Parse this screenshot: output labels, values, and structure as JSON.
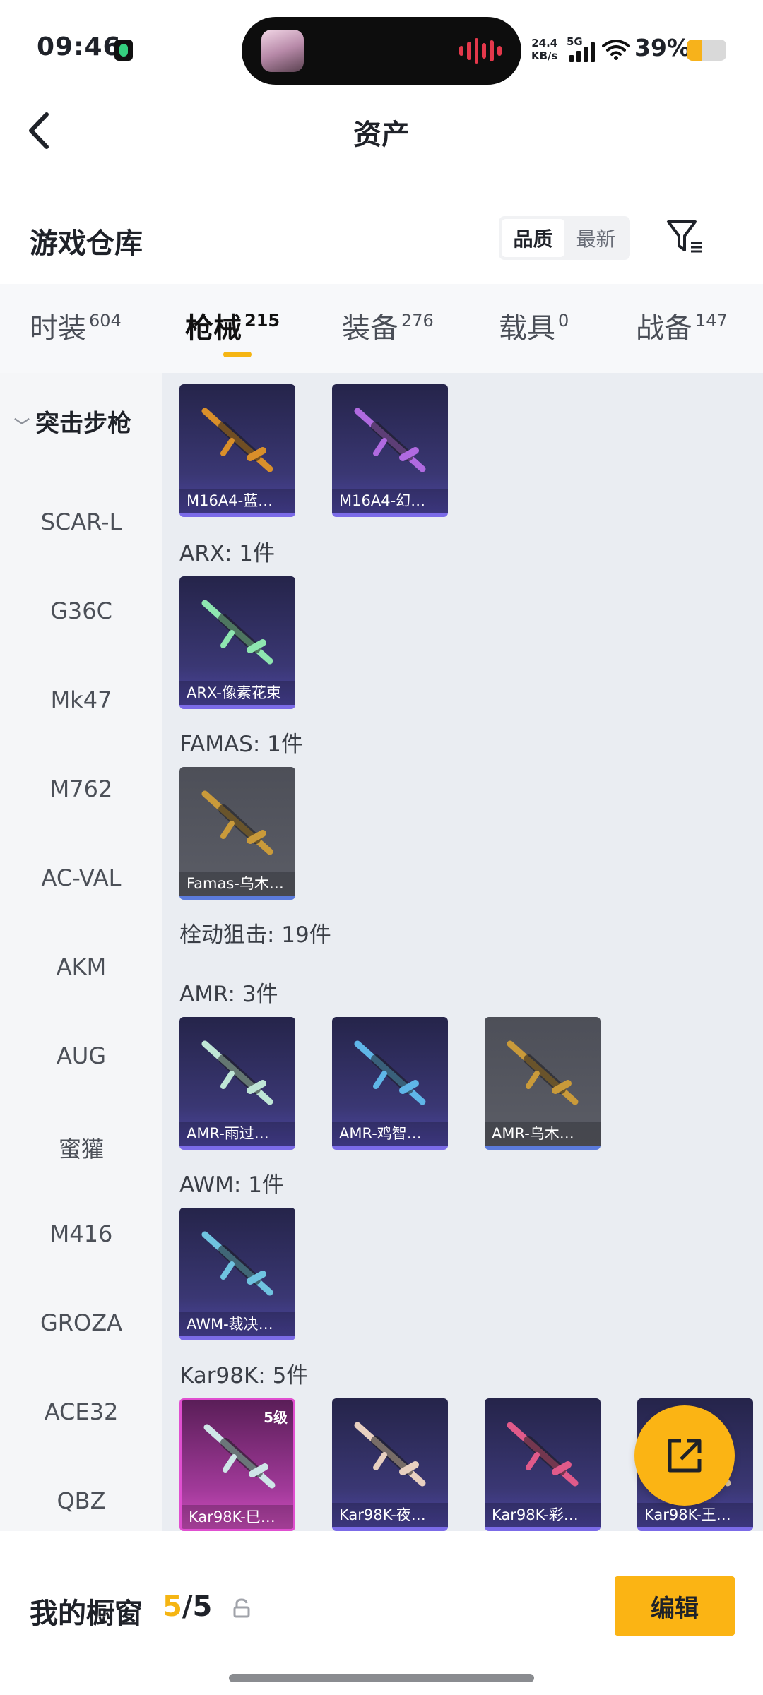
{
  "status_bar": {
    "time": "09:46",
    "net_speed_value": "24.4",
    "net_speed_unit": "KB/s",
    "network": "5G",
    "battery": "39%",
    "battery_level": 0.39
  },
  "header": {
    "title": "资产"
  },
  "section": {
    "title": "游戏仓库",
    "sort_options": [
      "品质",
      "最新"
    ],
    "sort_selected": "品质"
  },
  "tabs": [
    {
      "label": "时装",
      "count": "604"
    },
    {
      "label": "枪械",
      "count": "215"
    },
    {
      "label": "装备",
      "count": "276"
    },
    {
      "label": "载具",
      "count": "0"
    },
    {
      "label": "战备",
      "count": "147"
    }
  ],
  "active_tab": "枪械",
  "subnav": {
    "header": "突击步枪",
    "items": [
      "SCAR-L",
      "G36C",
      "Mk47",
      "M762",
      "AC-VAL",
      "AKM",
      "AUG",
      "蜜獾",
      "M416",
      "GROZA",
      "ACE32",
      "QBZ"
    ]
  },
  "content": {
    "top_cards": [
      {
        "name": "M16A4-蓝…",
        "style": "purple",
        "color": "#d98f2a"
      },
      {
        "name": "M16A4-幻…",
        "style": "purple",
        "color": "#b06ae0"
      }
    ],
    "groups": [
      {
        "label": "ARX: 1件",
        "cards": [
          {
            "name": "ARX-像素花束",
            "style": "purple",
            "color": "#8ee6b0"
          }
        ]
      },
      {
        "label": "FAMAS: 1件",
        "cards": [
          {
            "name": "Famas-乌木…",
            "style": "gray",
            "color": "#c99a3a"
          }
        ]
      },
      {
        "label": "栓动狙击: 19件",
        "cards": []
      },
      {
        "label": "AMR: 3件",
        "cards": [
          {
            "name": "AMR-雨过…",
            "style": "purple",
            "color": "#bfe6d6"
          },
          {
            "name": "AMR-鸡智…",
            "style": "purple",
            "color": "#5fb6e8"
          },
          {
            "name": "AMR-乌木…",
            "style": "gray",
            "color": "#c99a3a"
          }
        ]
      },
      {
        "label": "AWM: 1件",
        "cards": [
          {
            "name": "AWM-裁决…",
            "style": "purple",
            "color": "#6fc3e0"
          }
        ]
      },
      {
        "label": "Kar98K: 5件",
        "cards": [
          {
            "name": "Kar98K-巳…",
            "style": "pink",
            "color": "#cfe6e8",
            "level": "5级"
          },
          {
            "name": "Kar98K-夜…",
            "style": "purple",
            "color": "#e8d0c0"
          },
          {
            "name": "Kar98K-彩…",
            "style": "purple",
            "color": "#e05a8a"
          },
          {
            "name": "Kar98K-王…",
            "style": "purple",
            "color": "#d8c4a0"
          }
        ]
      }
    ]
  },
  "bottom": {
    "showcase_label": "我的橱窗",
    "showcase_current": "5",
    "showcase_total": "/5",
    "edit_label": "编辑"
  },
  "colors": {
    "accent": "#fbb414",
    "tab_underline": "#f5b513"
  }
}
